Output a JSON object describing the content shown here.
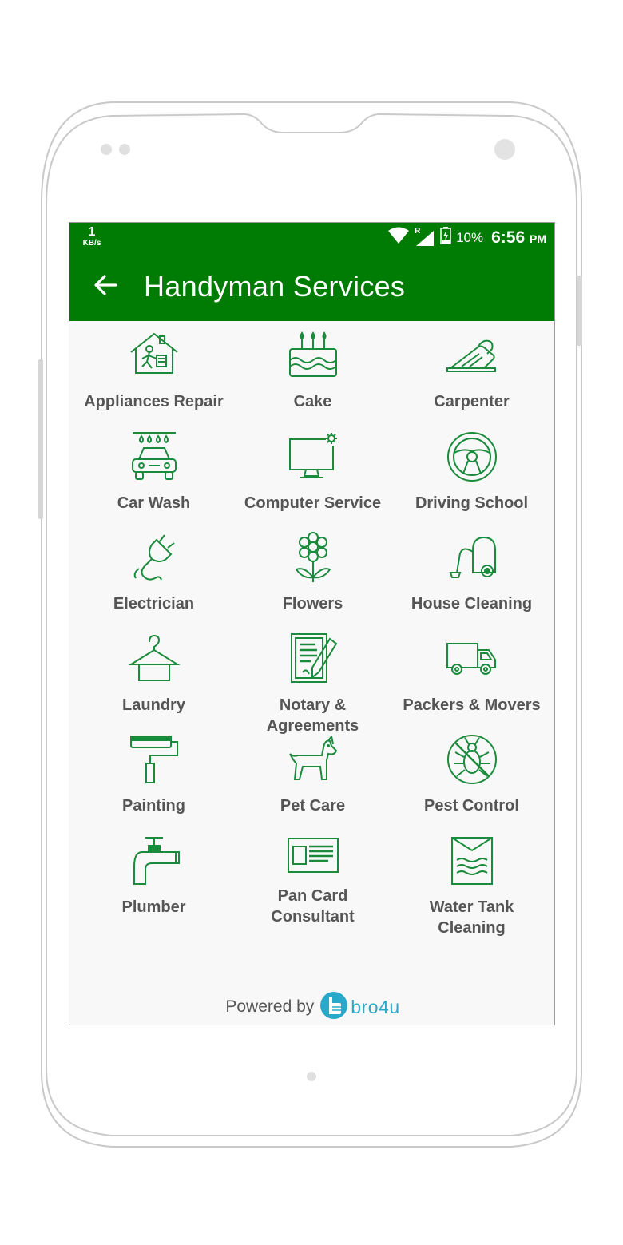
{
  "status_bar": {
    "speed_value": "1",
    "speed_unit": "KB/s",
    "roaming": "R",
    "battery": "10%",
    "time": "6:56",
    "ampm": "PM"
  },
  "app_bar": {
    "title": "Handyman Services",
    "back_icon": "arrow-left-icon"
  },
  "categories": [
    {
      "label": "Appliances Repair",
      "icon": "appliance-repair-icon"
    },
    {
      "label": "Cake",
      "icon": "cake-icon"
    },
    {
      "label": "Carpenter",
      "icon": "carpenter-plane-icon"
    },
    {
      "label": "Car Wash",
      "icon": "car-wash-icon"
    },
    {
      "label": "Computer Service",
      "icon": "computer-monitor-icon"
    },
    {
      "label": "Driving School",
      "icon": "steering-wheel-icon"
    },
    {
      "label": "Electrician",
      "icon": "electric-plug-icon"
    },
    {
      "label": "Flowers",
      "icon": "flower-icon"
    },
    {
      "label": "House Cleaning",
      "icon": "vacuum-cleaner-icon"
    },
    {
      "label": "Laundry",
      "icon": "hanger-icon"
    },
    {
      "label": "Notary &\nAgreements",
      "icon": "document-pen-icon"
    },
    {
      "label": "Packers & Movers",
      "icon": "delivery-van-icon"
    },
    {
      "label": "Painting",
      "icon": "paint-roller-icon"
    },
    {
      "label": "Pet Care",
      "icon": "dog-icon"
    },
    {
      "label": "Pest Control",
      "icon": "no-bug-icon"
    },
    {
      "label": "Plumber",
      "icon": "faucet-icon"
    },
    {
      "label": "Pan Card\nConsultant",
      "icon": "id-card-icon"
    },
    {
      "label": "Water Tank\nCleaning",
      "icon": "water-tank-icon"
    }
  ],
  "footer": {
    "powered_by": "Powered by",
    "brand": "bro4u",
    "brand_icon": "thumbs-up-icon"
  },
  "colors": {
    "primary": "#007b03",
    "icon_green": "#1a8a3c",
    "label_gray": "#555555",
    "brand_blue": "#29a9c9"
  }
}
